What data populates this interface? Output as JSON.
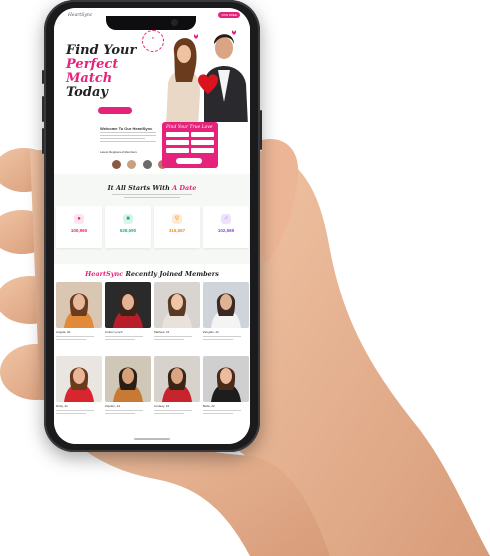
{
  "site": {
    "logo": "HeartSync",
    "join_label": "JOIN FREE",
    "colors": {
      "accent": "#e5237b",
      "dark": "#222222",
      "bg": "#f6f8f6"
    }
  },
  "hero": {
    "title_line1": "Find Your",
    "title_line2": "Perfect Match",
    "title_line3": "Today",
    "subtitle": "",
    "link_label": "",
    "cta_label": "",
    "stat_members": "",
    "stat_percent": "",
    "badge_text": ""
  },
  "welcome": {
    "title": "Welcome To Our HeartSync",
    "members_label": "Latest Registered Members"
  },
  "form": {
    "title": "Find Your True Love",
    "fields": [
      "",
      "",
      "",
      "",
      "",
      ""
    ],
    "button_label": ""
  },
  "section2": {
    "title_prefix": "It All Starts With",
    "title_accent": "A Date",
    "cards": [
      {
        "icon": "users-icon",
        "value": "100,960",
        "label": "",
        "color": "#e5237b",
        "bg": "#fde3ef"
      },
      {
        "icon": "chat-icon",
        "value": "628,590",
        "label": "",
        "color": "#1bb37a",
        "bg": "#d9f4e8"
      },
      {
        "icon": "search-icon",
        "value": "316,587",
        "label": "",
        "color": "#f08c1c",
        "bg": "#fdebd6"
      },
      {
        "icon": "gender-icon",
        "value": "102,569",
        "label": "",
        "color": "#7e4bd8",
        "bg": "#ece3fb"
      }
    ]
  },
  "section3": {
    "title_accent": "HeartSync",
    "title_rest": "Recently Joined Members",
    "members": [
      {
        "name": "Angela, 20",
        "skin": "#e8b89a",
        "top": "#e08a3a",
        "hair": "#6b3b1e",
        "bg": "#d9c6b3"
      },
      {
        "name": "Amber Lynch",
        "skin": "#e4b294",
        "top": "#b81d2a",
        "hair": "#3b2418",
        "bg": "#2a2a2a"
      },
      {
        "name": "Mathew, 21",
        "skin": "#f0c4a6",
        "top": "#e9e2da",
        "hair": "#5a3a24",
        "bg": "#d8d4cf"
      },
      {
        "name": "Zengfax, 22",
        "skin": "#e0b294",
        "top": "#f4f4f4",
        "hair": "#3a2a22",
        "bg": "#cfd4da"
      },
      {
        "name": "Ruby, 21",
        "skin": "#e9b697",
        "top": "#d9262e",
        "hair": "#6a3a1c",
        "bg": "#e9e6e2"
      },
      {
        "name": "Zayden, 24",
        "skin": "#d6a07a",
        "top": "#c87a35",
        "hair": "#2b1d14",
        "bg": "#cfc8b8"
      },
      {
        "name": "Lindsay, 24",
        "skin": "#dba584",
        "top": "#c8242b",
        "hair": "#3a2416",
        "bg": "#d7d2cc"
      },
      {
        "name": "Bella, 22",
        "skin": "#eabb9c",
        "top": "#1d1d1d",
        "hair": "#4a2a18",
        "bg": "#cfcfcf"
      }
    ]
  }
}
